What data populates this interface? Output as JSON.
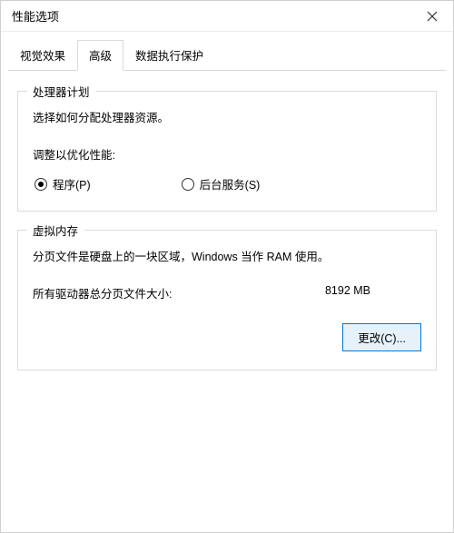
{
  "window": {
    "title": "性能选项"
  },
  "tabs": {
    "visual": "视觉效果",
    "advanced": "高级",
    "dep": "数据执行保护",
    "active": "advanced"
  },
  "processor": {
    "group_title": "处理器计划",
    "description": "选择如何分配处理器资源。",
    "adjust_label": "调整以优化性能:",
    "option_programs": "程序(P)",
    "option_background": "后台服务(S)",
    "selected": "programs"
  },
  "vm": {
    "group_title": "虚拟内存",
    "description": "分页文件是硬盘上的一块区域，Windows 当作 RAM 使用。",
    "total_label": "所有驱动器总分页文件大小:",
    "total_value": "8192 MB",
    "change_button": "更改(C)..."
  }
}
